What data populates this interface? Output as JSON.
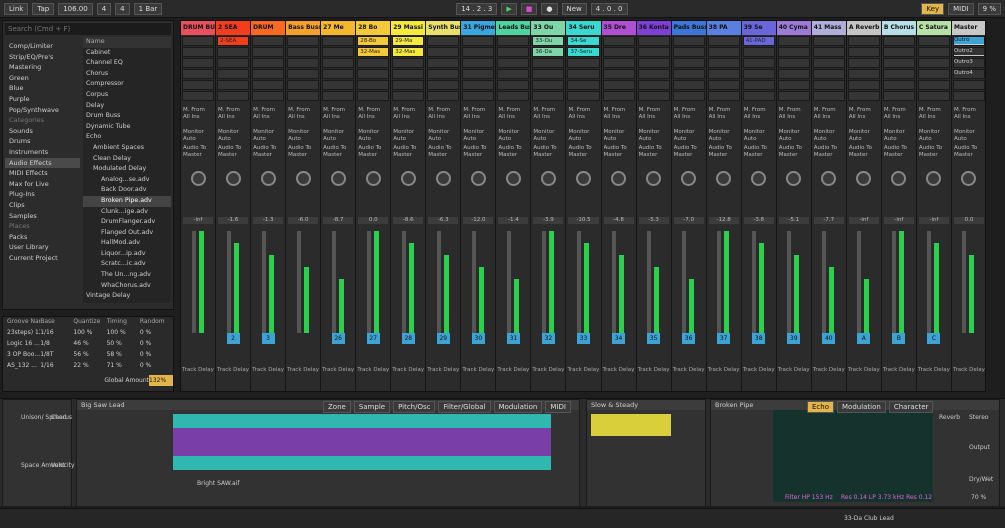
{
  "transport": {
    "link": "Link",
    "tap": "Tap",
    "tempo": "106.00",
    "sig_num": "4",
    "sig_den": "4",
    "quantize": "1 Bar",
    "position": "14 . 2 . 3",
    "loop_len": "4 . 0 . 0",
    "new": "New",
    "key": "Key",
    "midi": "MIDI",
    "cpu": "9 %"
  },
  "browser": {
    "search_placeholder": "Search (Cmd + F)",
    "collections": [
      "Comp/Limiter",
      "Strip/EQ/Pre's",
      "Mastering",
      "Green",
      "Blue",
      "Purple",
      "Pop/Synthwave"
    ],
    "categories_header": "Categories",
    "categories": [
      "Sounds",
      "Drums",
      "Instruments",
      "Audio Effects",
      "MIDI Effects",
      "Max for Live",
      "Plug-Ins",
      "Clips",
      "Samples"
    ],
    "places_header": "Places",
    "places": [
      "Packs",
      "User Library",
      "Current Project"
    ],
    "name_header": "Name",
    "items": [
      "Cabinet",
      "Channel EQ",
      "Chorus",
      "Compressor",
      "Corpus",
      "Delay",
      "Drum Buss",
      "Dynamic Tube",
      "Echo",
      "Ambient Spaces",
      "Clean Delay",
      "Modulated Delay",
      "Analog...se.adv",
      "Back Door.adv",
      "Broken Pipe.adv",
      "Clunk...ige.adv",
      "DrumFlanger.adv",
      "Flanged Out.adv",
      "HallMod.adv",
      "Liquor...ip.adv",
      "Scratc...ic.adv",
      "The Un...ng.adv",
      "WhaChorus.adv",
      "Vintage Delay"
    ]
  },
  "groove": {
    "headers": [
      "Groove Name",
      "Base",
      "Quantize",
      "Timing",
      "Random"
    ],
    "rows": [
      [
        "23steps) 130",
        "1/16",
        "100 %",
        "100 %",
        "0 %"
      ],
      [
        "Logic 16 ...",
        "1/8",
        "46 %",
        "50 %",
        "0 %"
      ],
      [
        "3 OP Boo...",
        "1/8T",
        "56 %",
        "58 %",
        "0 %"
      ],
      [
        "AS_132 ...",
        "1/16",
        "22 %",
        "71 %",
        "0 %"
      ]
    ],
    "global_label": "Global Amount",
    "global_value": "132%"
  },
  "tracks": [
    {
      "name": "DRUM BU",
      "color": "#e7505f",
      "num": "",
      "vol": "-inf",
      "clips": [
        "",
        ""
      ]
    },
    {
      "name": "2 SEA",
      "color": "#f23e1a",
      "num": "2",
      "vol": "-1.6",
      "clips": [
        "2-SEA",
        ""
      ]
    },
    {
      "name": "DRUM",
      "color": "#f96a20",
      "num": "3",
      "vol": "-1.3",
      "clips": [
        "",
        ""
      ]
    },
    {
      "name": "Bass Buss",
      "color": "#f7a12c",
      "num": "",
      "vol": "-6.0",
      "clips": [
        "",
        ""
      ]
    },
    {
      "name": "27 Me",
      "color": "#f5b82b",
      "num": "26",
      "vol": "-8.7",
      "clips": [
        "",
        ""
      ]
    },
    {
      "name": "28 Bo",
      "color": "#f5c838",
      "num": "27",
      "vol": "0.0",
      "clips": [
        "28-Bo",
        "32-Mas"
      ]
    },
    {
      "name": "29 Massi",
      "color": "#f5ea3b",
      "num": "28",
      "vol": "-8.6",
      "clips": [
        "29-Ma",
        "32-Mas"
      ]
    },
    {
      "name": "Synth Buss",
      "color": "#e8e06b",
      "num": "29",
      "vol": "-6.3",
      "clips": [
        "",
        ""
      ]
    },
    {
      "name": "31 Pigme",
      "color": "#3aa6e0",
      "num": "30",
      "vol": "-12.0",
      "clips": [
        "",
        ""
      ]
    },
    {
      "name": "Leads Buss",
      "color": "#4fd1a1",
      "num": "31",
      "vol": "-1.4",
      "clips": [
        "",
        ""
      ]
    },
    {
      "name": "33 Ou",
      "color": "#7ed5a8",
      "num": "32",
      "vol": "-3.9",
      "clips": [
        "33-Ou",
        "36-Da"
      ]
    },
    {
      "name": "34 Seru",
      "color": "#39d8d0",
      "num": "33",
      "vol": "-10.5",
      "clips": [
        "34-Se",
        "37-Seru"
      ]
    },
    {
      "name": "35 Dre",
      "color": "#b04fd4",
      "num": "34",
      "vol": "-4.8",
      "clips": [
        "",
        ""
      ]
    },
    {
      "name": "36 Konta",
      "color": "#7e3fd6",
      "num": "35",
      "vol": "-5.3",
      "clips": [
        "",
        ""
      ]
    },
    {
      "name": "Pads Buss",
      "color": "#3c76d6",
      "num": "36",
      "vol": "-7.0",
      "clips": [
        "",
        ""
      ]
    },
    {
      "name": "38 PA",
      "color": "#5a7fe0",
      "num": "37",
      "vol": "-12.8",
      "clips": [
        "",
        ""
      ]
    },
    {
      "name": "39 Se",
      "color": "#6a66d9",
      "num": "38",
      "vol": "-3.8",
      "clips": [
        "41-PAD",
        ""
      ]
    },
    {
      "name": "40 Cyma",
      "color": "#9c7bd8",
      "num": "39",
      "vol": "-5.1",
      "clips": [
        "",
        ""
      ]
    },
    {
      "name": "41 Mass",
      "color": "#aeaed8",
      "num": "40",
      "vol": "-7.7",
      "clips": [
        "",
        ""
      ]
    },
    {
      "name": "A Reverb",
      "color": "#c4c4c4",
      "num": "A",
      "vol": "-inf",
      "clips": [
        "",
        ""
      ]
    },
    {
      "name": "B Chorus",
      "color": "#b7dfe8",
      "num": "B",
      "vol": "-inf",
      "clips": [
        "",
        ""
      ]
    },
    {
      "name": "C Satura",
      "color": "#b8e0a8",
      "num": "C",
      "vol": "-inf",
      "clips": [
        "",
        ""
      ]
    },
    {
      "name": "Master",
      "color": "#c8c8c8",
      "num": "",
      "vol": "0.0",
      "clips": [
        "Outro",
        "Outro2"
      ]
    }
  ],
  "io_labels": {
    "midi_from": "M. From",
    "all_ins": "All Ins",
    "monitor": "Monitor",
    "auto": "Auto",
    "audio_to": "Audio To",
    "master": "Master",
    "sends": "Sends",
    "track_delay": "Track Delay",
    "ms": "ms",
    "cue_out": "Cue Out",
    "master_out": "Master Out"
  },
  "scenes": [
    "Outro",
    "Outro2",
    "Outro3",
    "Outro4"
  ],
  "detail": {
    "sampler_title": "Big Saw Lead",
    "sampler_tabs": [
      "Zone",
      "Sample",
      "Pitch/Osc",
      "Filter/Global",
      "Modulation",
      "MIDI"
    ],
    "sample_name": "Bright SAW.aif",
    "unison": "Unison/ Spread",
    "chorus": "Chorus",
    "space": "Space Amount",
    "velocity": "Velocity Sens",
    "slow_steady": "Slow & Steady",
    "broken_pipe": "Broken Pipe",
    "echo_tabs": [
      "Echo",
      "Modulation",
      "Character"
    ],
    "reverb": "Reverb",
    "stereo": "Stereo",
    "output": "Output",
    "drywet": "Dry/Wet",
    "drywet_val": "70 %",
    "filter_label": "Filter HP 153 Hz",
    "res_label": "Res 0.14 LP 3.73 kHz Res 0.12"
  },
  "status": {
    "clip_name": "33-Da Club Lead"
  }
}
